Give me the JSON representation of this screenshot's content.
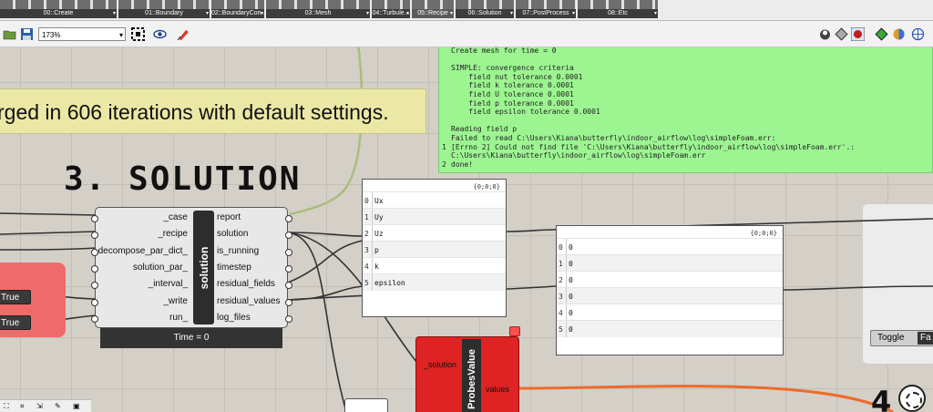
{
  "ribbon": {
    "tabs": [
      {
        "label": "00::Create",
        "active": false
      },
      {
        "label": "01::Boundary",
        "active": false
      },
      {
        "label": "02::BoundaryCon...",
        "active": false
      },
      {
        "label": "03::Mesh",
        "active": false
      },
      {
        "label": "04::Turbule...",
        "active": false
      },
      {
        "label": "05::Recipe",
        "active": true
      },
      {
        "label": "06::Solution",
        "active": false
      },
      {
        "label": "07::PostProcess",
        "active": false
      },
      {
        "label": "08::Etc",
        "active": false
      }
    ]
  },
  "toolbar": {
    "zoom": "173%",
    "icons": [
      "open-file-icon",
      "save-icon",
      "zoom-extents-icon",
      "preview-eye-icon",
      "sketch-pen-icon",
      "preview-mode-icon",
      "paint-icon",
      "bake-icon",
      "display-icon",
      "shaded-sphere-icon",
      "globe-icon"
    ]
  },
  "canvas": {
    "note_text": "rged in 606 iterations with default settings.",
    "section_title": "3. SOLUTION",
    "log_panel": {
      "lines": [
        {
          "num": "",
          "text": "Create mesh for time = 0"
        },
        {
          "num": "",
          "text": ""
        },
        {
          "num": "",
          "text": "SIMPLE: convergence criteria"
        },
        {
          "num": "",
          "text": "    field nut tolerance 0.0001"
        },
        {
          "num": "",
          "text": "    field k tolerance 0.0001"
        },
        {
          "num": "",
          "text": "    field U tolerance 0.0001"
        },
        {
          "num": "",
          "text": "    field p tolerance 0.0001"
        },
        {
          "num": "",
          "text": "    field epsilon tolerance 0.0001"
        },
        {
          "num": "",
          "text": ""
        },
        {
          "num": "",
          "text": "Reading field p"
        },
        {
          "num": "",
          "text": "Failed to read C:\\Users\\Kiana\\butterfly\\indoor_airflow\\log\\simpleFoam.err:"
        },
        {
          "num": "1",
          "text": "[Errno 2] Could not find file 'C:\\Users\\Kiana\\butterfly\\indoor_airflow\\log\\simpleFoam.err'.:"
        },
        {
          "num": "",
          "text": "C:\\Users\\Kiana\\butterfly\\indoor_airflow\\log\\simpleFoam.err"
        },
        {
          "num": "2",
          "text": "done!"
        }
      ]
    },
    "solution_component": {
      "name": "solution",
      "inputs": [
        "_case",
        "_recipe",
        "decompose_par_dict_",
        "solution_par_",
        "_interval_",
        "_write",
        "run_"
      ],
      "outputs": [
        "report",
        "solution",
        "is_running",
        "timestep",
        "residual_fields",
        "residual_values",
        "log_files"
      ],
      "status": "Time = 0"
    },
    "toggles": [
      "True",
      "True"
    ],
    "fields_panel": {
      "header": "{0;0;0}",
      "rows": [
        {
          "i": "0",
          "v": "Ux"
        },
        {
          "i": "1",
          "v": "Uy"
        },
        {
          "i": "2",
          "v": "Uz"
        },
        {
          "i": "3",
          "v": "p"
        },
        {
          "i": "4",
          "v": "k"
        },
        {
          "i": "5",
          "v": "epsilon"
        }
      ]
    },
    "values_panel": {
      "header": "{0;0;0}",
      "rows": [
        {
          "i": "0",
          "v": "0"
        },
        {
          "i": "1",
          "v": "0"
        },
        {
          "i": "2",
          "v": "0"
        },
        {
          "i": "3",
          "v": "0"
        },
        {
          "i": "4",
          "v": "0"
        },
        {
          "i": "5",
          "v": "0"
        }
      ]
    },
    "probes_component": {
      "name": "ProbesValue",
      "input": "_solution",
      "output": "values"
    },
    "toggle_component": {
      "label": "Toggle",
      "value": "Fa"
    },
    "corner_number": "4"
  },
  "colors": {
    "log_bg": "#9cf591",
    "note_bg": "#ebe8a6",
    "probe_red": "#dd2323",
    "group_red": "#ef6b6b",
    "wire_orange": "#f06a2a"
  }
}
